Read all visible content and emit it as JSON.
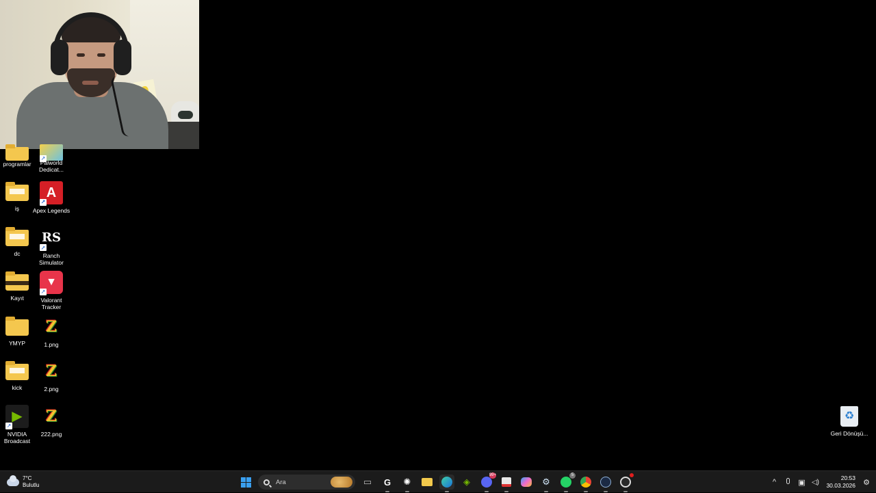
{
  "desktop": {
    "icons": [
      {
        "label": "programlar",
        "type": "folder"
      },
      {
        "label": "Palworld Dedicat...",
        "type": "palworld"
      },
      {
        "label": "iş",
        "type": "folder"
      },
      {
        "label": "Apex Legends",
        "type": "apex",
        "glyph": "A"
      },
      {
        "label": "dc",
        "type": "folder"
      },
      {
        "label": "Ranch Simulator",
        "type": "ranch",
        "glyph": "RS"
      },
      {
        "label": "Kayıt",
        "type": "folder-dark"
      },
      {
        "label": "Valorant Tracker",
        "type": "valorant"
      },
      {
        "label": "YMYP",
        "type": "folder"
      },
      {
        "label": "1.png",
        "type": "png",
        "glyph": "Z"
      },
      {
        "label": "kick",
        "type": "folder-doc"
      },
      {
        "label": "2.png",
        "type": "png",
        "glyph": "Z"
      },
      {
        "label": "NVIDIA Broadcast",
        "type": "nvidia"
      },
      {
        "label": "222.png",
        "type": "png",
        "glyph": "Z"
      },
      {
        "label": "Geri Dönüşü...",
        "type": "recycle-bin"
      }
    ]
  },
  "webcam": {
    "icon": "webcam-overlay"
  },
  "taskbar": {
    "weather": {
      "temp": "7°C",
      "condition": "Bulutlu",
      "icon": "cloud-icon"
    },
    "search": {
      "placeholder": "Ara"
    },
    "apps": [
      {
        "name": "task-view",
        "glyph": "▭"
      },
      {
        "name": "logitech-g-hub",
        "glyph": "G"
      },
      {
        "name": "chatgpt",
        "glyph": "✺"
      },
      {
        "name": "file-explorer",
        "glyph": ""
      },
      {
        "name": "edge",
        "glyph": "e"
      },
      {
        "name": "nvidia",
        "glyph": "◈"
      },
      {
        "name": "discord",
        "glyph": "☺",
        "badge": "99+"
      },
      {
        "name": "snipping-tool",
        "glyph": "✂"
      },
      {
        "name": "copilot",
        "glyph": "◆"
      },
      {
        "name": "settings-gear",
        "glyph": "⚙"
      },
      {
        "name": "whatsapp",
        "glyph": "✆",
        "badge": "5"
      },
      {
        "name": "chrome",
        "glyph": "●"
      },
      {
        "name": "steam",
        "glyph": "⟳"
      },
      {
        "name": "obs",
        "glyph": "◎",
        "badge": ""
      }
    ],
    "tray": {
      "chevron": "^",
      "mic": "🎙",
      "network": "▣",
      "volume": "🔊",
      "time": "20:53",
      "date": "30.03.2026",
      "app": "⚙"
    }
  }
}
